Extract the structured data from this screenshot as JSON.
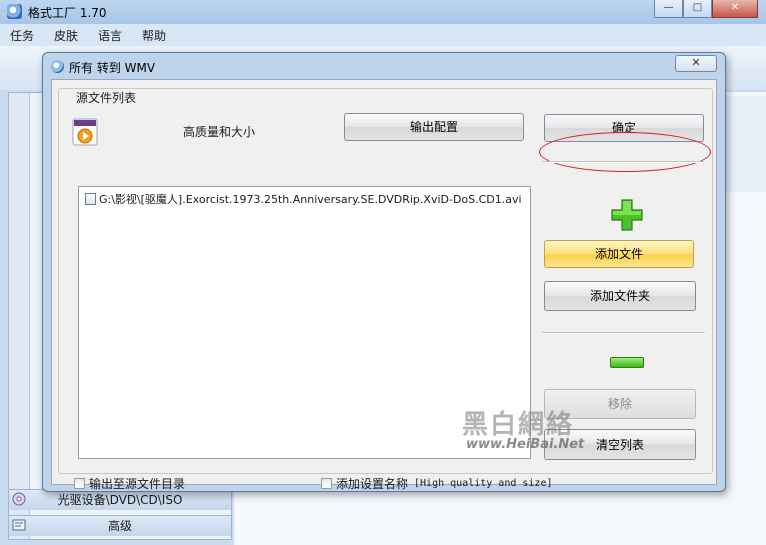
{
  "app": {
    "title": "格式工厂 1.70",
    "window_buttons": {
      "minimize": "—",
      "maximize": "□",
      "close": "✕"
    }
  },
  "menubar": [
    "任务",
    "皮肤",
    "语言",
    "帮助"
  ],
  "sidebar": {
    "items": [
      {
        "label": "光驱设备\\DVD\\CD\\ISO",
        "icon": "disc-icon"
      },
      {
        "label": "高级",
        "icon": "advanced-icon"
      }
    ]
  },
  "dialog": {
    "title": "所有 转到 WMV",
    "close_label": "✕",
    "group_label": "源文件列表",
    "quality_label": "高质量和大小",
    "output_config_button": "输出配置",
    "ok_button": "确定",
    "add_file_button": "添加文件",
    "add_folder_button": "添加文件夹",
    "remove_button": "移除",
    "clear_list_button": "清空列表",
    "files": [
      "G:\\影视\\[驱魔人].Exorcist.1973.25th.Anniversary.SE.DVDRip.XviD-DoS.CD1.avi"
    ],
    "output_to_source_label": "输出至源文件目录",
    "add_setting_name_label": "添加设置名称",
    "setting_name_hint": "[High quality and size]"
  },
  "watermark": {
    "cn": "黑白網絡",
    "en": "www.HeiBai.Net"
  },
  "colors": {
    "titlebar": "#a7c5e6",
    "dialog_frame": "#bfd3ea",
    "hot_button": "#fcd24a",
    "annotation_red": "#d0202a",
    "plus_green": "#3fb21b"
  }
}
